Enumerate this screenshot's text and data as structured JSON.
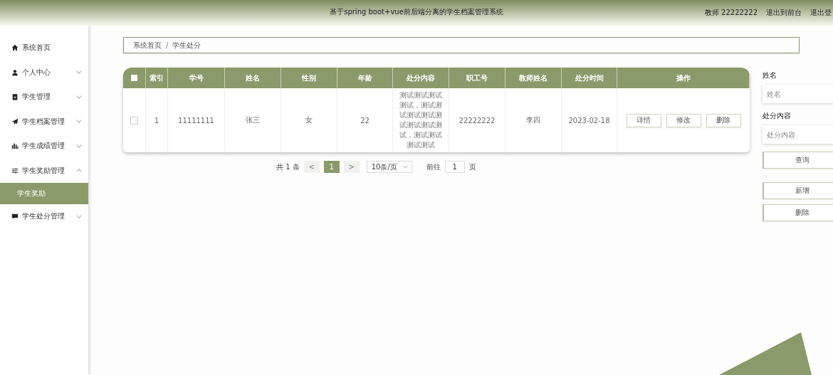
{
  "header": {
    "title": "基于spring boot+vue前后端分离的学生档案管理系统",
    "user": "教师 22222222",
    "links": [
      "退出到前台",
      "退出登"
    ]
  },
  "sidebar": {
    "items": [
      {
        "label": "系统首页",
        "kind": "link"
      },
      {
        "label": "个人中心",
        "kind": "group",
        "expanded": false
      },
      {
        "label": "学生管理",
        "kind": "group",
        "expanded": false
      },
      {
        "label": "学生档案管理",
        "kind": "group",
        "expanded": false
      },
      {
        "label": "学生成绩管理",
        "kind": "group",
        "expanded": false
      },
      {
        "label": "学生奖励管理",
        "kind": "group",
        "expanded": true,
        "children": [
          {
            "label": "学生奖励",
            "selected": true
          }
        ]
      },
      {
        "label": "学生处分管理",
        "kind": "group",
        "expanded": false
      }
    ]
  },
  "breadcrumb": {
    "items": [
      "系统首页",
      "学生处分"
    ],
    "separator": "/"
  },
  "table": {
    "all_selected": false,
    "columns": [
      "索引",
      "学号",
      "姓名",
      "性别",
      "年龄",
      "处分内容",
      "职工号",
      "教师姓名",
      "处分时间",
      "操作"
    ],
    "rows": [
      {
        "checked": false,
        "cells": [
          "1",
          "11111111",
          "张三",
          "女",
          "22",
          "测试测试测试测试，测试测试测试测试测试测试测试测试，测试测试测试测试",
          "22222222",
          "李四",
          "2023-02-18"
        ],
        "actions": [
          "详情",
          "修改",
          "删除"
        ]
      }
    ]
  },
  "pagination": {
    "total": "共 1 条",
    "prev": "<",
    "pages": [
      {
        "label": "1",
        "selected": true
      }
    ],
    "next": ">",
    "page_size": "10条/页",
    "goto": "前往",
    "goto_value": "1",
    "page_unit": "页"
  },
  "search": {
    "fields": [
      {
        "label": "姓名",
        "placeholder": "姓名"
      },
      {
        "label": "处分内容",
        "placeholder": "处分内容"
      }
    ],
    "buttons": [
      "查询",
      "新增",
      "删除"
    ]
  }
}
